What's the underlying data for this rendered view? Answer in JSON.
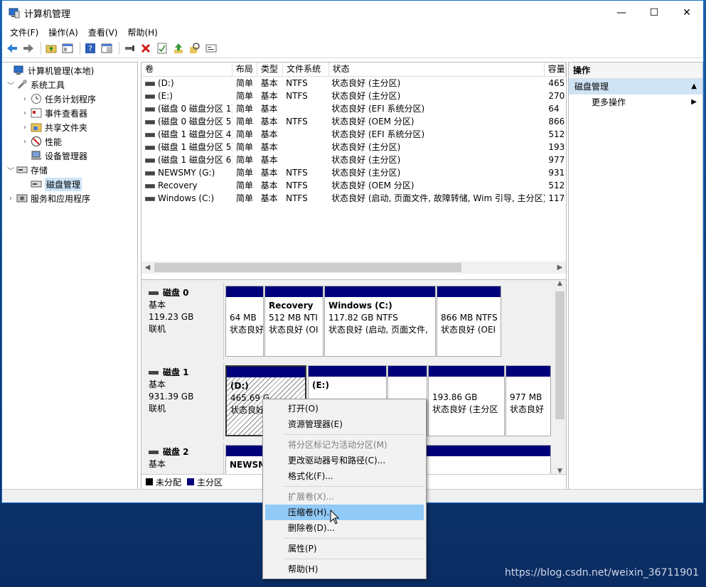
{
  "window": {
    "title": "计算机管理",
    "min": "—",
    "max": "☐",
    "close": "✕"
  },
  "menubar": [
    "文件(F)",
    "操作(A)",
    "查看(V)",
    "帮助(H)"
  ],
  "tree": {
    "root": "计算机管理(本地)",
    "system_tools": "系统工具",
    "task_scheduler": "任务计划程序",
    "event_viewer": "事件查看器",
    "shared_folders": "共享文件夹",
    "performance": "性能",
    "device_manager": "设备管理器",
    "storage": "存储",
    "disk_management": "磁盘管理",
    "services": "服务和应用程序"
  },
  "volumes": {
    "headers": [
      "卷",
      "布局",
      "类型",
      "文件系统",
      "状态",
      "容量"
    ],
    "rows": [
      [
        "(D:)",
        "简单",
        "基本",
        "NTFS",
        "状态良好 (主分区)",
        "465"
      ],
      [
        "(E:)",
        "简单",
        "基本",
        "NTFS",
        "状态良好 (主分区)",
        "270"
      ],
      [
        "(磁盘 0 磁盘分区 1)",
        "简单",
        "基本",
        "",
        "状态良好 (EFI 系统分区)",
        "64"
      ],
      [
        "(磁盘 0 磁盘分区 5)",
        "简单",
        "基本",
        "NTFS",
        "状态良好 (OEM 分区)",
        "866"
      ],
      [
        "(磁盘 1 磁盘分区 4)",
        "简单",
        "基本",
        "",
        "状态良好 (EFI 系统分区)",
        "512"
      ],
      [
        "(磁盘 1 磁盘分区 5)",
        "简单",
        "基本",
        "",
        "状态良好 (主分区)",
        "193"
      ],
      [
        "(磁盘 1 磁盘分区 6)",
        "简单",
        "基本",
        "",
        "状态良好 (主分区)",
        "977"
      ],
      [
        "NEWSMY (G:)",
        "简单",
        "基本",
        "NTFS",
        "状态良好 (主分区)",
        "931"
      ],
      [
        "Recovery",
        "简单",
        "基本",
        "NTFS",
        "状态良好 (OEM 分区)",
        "512"
      ],
      [
        "Windows (C:)",
        "简单",
        "基本",
        "NTFS",
        "状态良好 (启动, 页面文件, 故障转储, Wim 引导, 主分区)",
        "117"
      ]
    ]
  },
  "disks": {
    "disk0": {
      "name": "磁盘 0",
      "type": "基本",
      "size": "119.23 GB",
      "status": "联机",
      "parts": [
        {
          "name": "",
          "size": "64 MB",
          "status": "状态良好"
        },
        {
          "name": "Recovery",
          "size": "512 MB NTI",
          "status": "状态良好 (OI"
        },
        {
          "name": "Windows  (C:)",
          "size": "117.82 GB NTFS",
          "status": "状态良好 (启动, 页面文件,"
        },
        {
          "name": "",
          "size": "866 MB NTFS",
          "status": "状态良好 (OEI"
        }
      ]
    },
    "disk1": {
      "name": "磁盘 1",
      "type": "基本",
      "size": "931.39 GB",
      "status": "联机",
      "parts": [
        {
          "name": "(D:)",
          "size": "465.69 G",
          "status": "状态良好"
        },
        {
          "name": "(E:)",
          "size": "",
          "status": ""
        },
        {
          "name": "",
          "size": "",
          "status": ""
        },
        {
          "name": "",
          "size": "193.86 GB",
          "status": "状态良好 (主分区"
        },
        {
          "name": "",
          "size": "977 MB",
          "status": "状态良好"
        }
      ]
    },
    "disk2": {
      "name": "磁盘 2",
      "type": "基本",
      "parts": [
        {
          "name": "NEWSMY"
        }
      ]
    }
  },
  "legend": {
    "unallocated": "未分配",
    "primary": "主分区"
  },
  "actions": {
    "header": "操作",
    "selected": "磁盘管理",
    "more": "更多操作"
  },
  "context_menu": {
    "open": "打开(O)",
    "explorer": "资源管理器(E)",
    "mark_active": "将分区标记为活动分区(M)",
    "change_letter": "更改驱动器号和路径(C)...",
    "format": "格式化(F)...",
    "extend": "扩展卷(X)...",
    "shrink": "压缩卷(H)...",
    "delete": "删除卷(D)...",
    "properties": "属性(P)",
    "help": "帮助(H)"
  },
  "watermark": "https://blog.csdn.net/weixin_36711901"
}
